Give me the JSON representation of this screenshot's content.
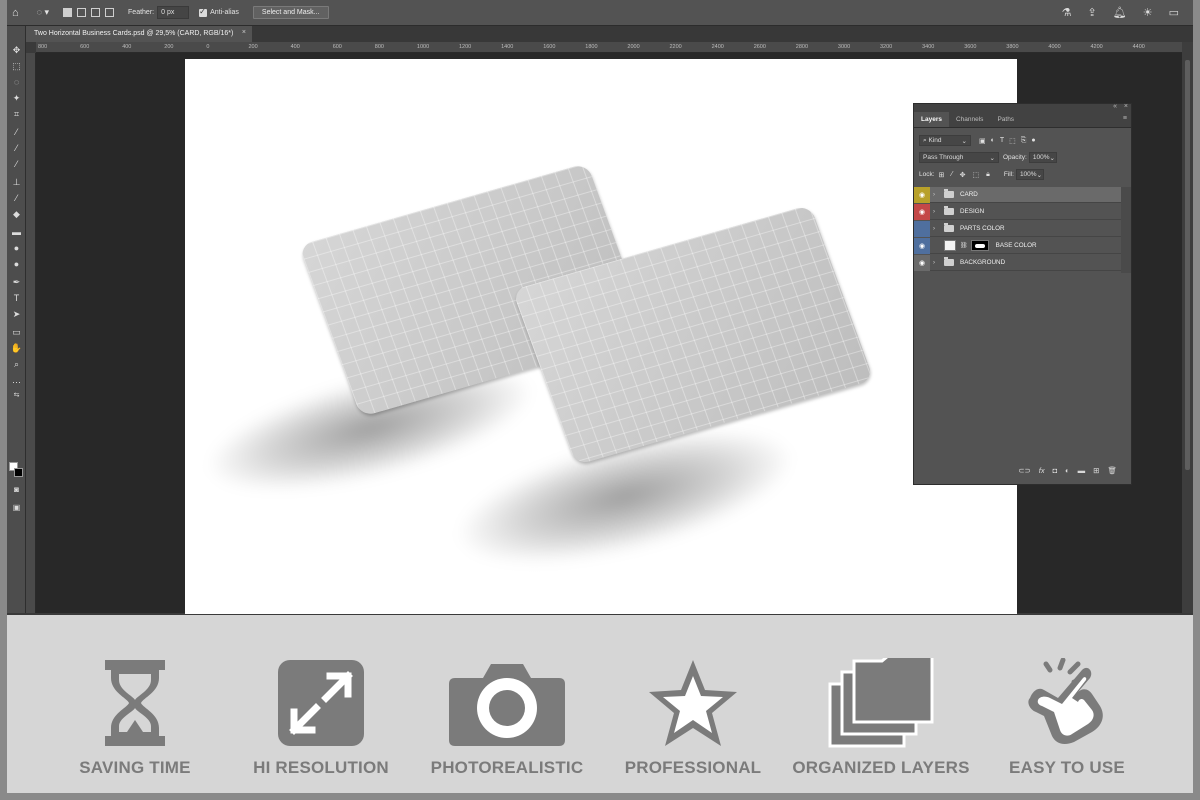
{
  "options_bar": {
    "feather_label": "Feather:",
    "feather_value": "0 px",
    "antialias_label": "Anti-alias",
    "select_mask_button": "Select and Mask..."
  },
  "document": {
    "tab_title": "Two Horizontal Business Cards.psd @ 29,5% (CARD, RGB/16*)",
    "close": "×"
  },
  "ruler": {
    "ticks": [
      "800",
      "600",
      "400",
      "200",
      "0",
      "200",
      "400",
      "600",
      "800",
      "1000",
      "1200",
      "1400",
      "1600",
      "1800",
      "2000",
      "2200",
      "2400",
      "2600",
      "2800",
      "3000",
      "3200",
      "3400",
      "3600",
      "3800",
      "4000",
      "4200",
      "4400"
    ]
  },
  "layers_panel": {
    "tabs": [
      "Layers",
      "Channels",
      "Paths"
    ],
    "filter_kind": "Kind",
    "blend_mode": "Pass Through",
    "opacity_label": "Opacity:",
    "opacity_value": "100%",
    "lock_label": "Lock:",
    "fill_label": "Fill:",
    "fill_value": "100%",
    "layers": [
      {
        "name": "CARD",
        "eye_color": "#b8a12a",
        "type": "group",
        "selected": true,
        "visible": true
      },
      {
        "name": "DESIGN",
        "eye_color": "#c44848",
        "type": "group",
        "selected": false,
        "visible": true
      },
      {
        "name": "PARTS COLOR",
        "eye_color": "#4f6f9e",
        "type": "group",
        "selected": false,
        "visible": false
      },
      {
        "name": "BASE COLOR",
        "eye_color": "#4f6f9e",
        "type": "layer-mask",
        "selected": false,
        "visible": true
      },
      {
        "name": "BACKGROUND",
        "eye_color": "#6a6a6a",
        "type": "group",
        "selected": false,
        "visible": true
      }
    ]
  },
  "features": [
    {
      "label": "SAVING TIME",
      "icon": "hourglass-icon"
    },
    {
      "label": "HI RESOLUTION",
      "icon": "expand-arrows-icon"
    },
    {
      "label": "PHOTOREALISTIC",
      "icon": "camera-icon"
    },
    {
      "label": "PROFESSIONAL",
      "icon": "star-icon"
    },
    {
      "label": "ORGANIZED LAYERS",
      "icon": "stacked-folders-icon"
    },
    {
      "label": "EASY TO USE",
      "icon": "pointing-hand-icon"
    }
  ],
  "colors": {
    "feature_icon": "#7b7b7b",
    "feature_bg": "#d6d6d6",
    "panel_bg": "#535353"
  }
}
